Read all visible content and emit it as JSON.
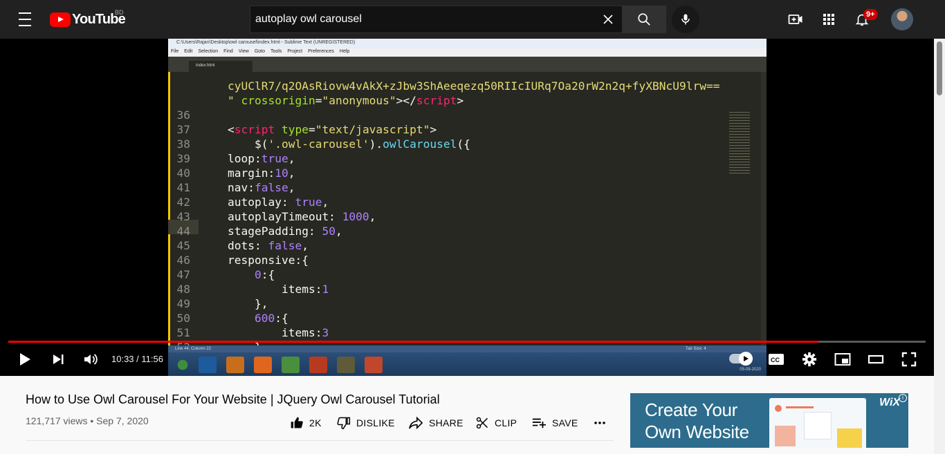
{
  "header": {
    "logo_text": "YouTube",
    "country_code": "BD",
    "search": {
      "value": "autoplay owl carousel",
      "placeholder": "Search"
    },
    "notification_badge": "9+"
  },
  "player": {
    "time": "10:33 / 11:56",
    "progress_fraction": 0.883,
    "screen": {
      "title": "C:\\Users\\Rajan\\Desktop\\owl carousel\\index.html - Sublime Text (UNREGISTERED)",
      "menu": [
        "File",
        "Edit",
        "Selection",
        "Find",
        "View",
        "Goto",
        "Tools",
        "Project",
        "Preferences",
        "Help"
      ],
      "tab": "index.html",
      "status": "Line 44, Column 22",
      "status_right": "Tab Size: 4",
      "date": "05-09-2020"
    }
  },
  "video": {
    "title": "How to Use Owl Carousel For Your Website | JQuery Owl Carousel Tutorial",
    "meta": "121,717 views • Sep 7, 2020"
  },
  "actions": {
    "like": "2K",
    "dislike": "DISLIKE",
    "share": "SHARE",
    "clip": "CLIP",
    "save": "SAVE"
  },
  "ad": {
    "line1": "Create Your",
    "line2": "Own Website",
    "brand": "WiX",
    "info": "i"
  },
  "colors": {
    "brand_red": "#ff0000",
    "topbar": "#212121",
    "ad_bg": "#2d6c8c"
  }
}
